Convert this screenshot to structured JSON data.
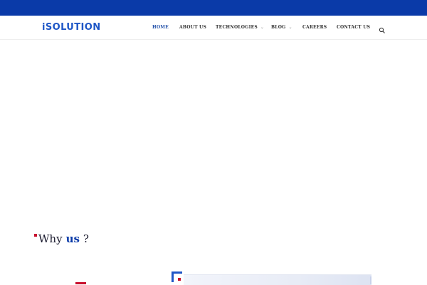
{
  "header": {
    "logo_text": "iSOLUTION",
    "nav": [
      {
        "label": "HOME",
        "active": true,
        "has_dropdown": false
      },
      {
        "label": "ABOUT US",
        "active": false,
        "has_dropdown": false
      },
      {
        "label": "TECHNOLOGIES",
        "active": false,
        "has_dropdown": true
      },
      {
        "label": "BLOG",
        "active": false,
        "has_dropdown": true
      },
      {
        "label": "CAREERS",
        "active": false,
        "has_dropdown": false
      },
      {
        "label": "CONTACT US",
        "active": false,
        "has_dropdown": false
      }
    ],
    "search_icon": "search-icon"
  },
  "section": {
    "why_text": "Why",
    "why_highlight": "us",
    "why_punct": "?"
  },
  "colors": {
    "brand_blue": "#0a3aa8",
    "accent_red": "#c8102e",
    "logo_blue": "#1e56c6"
  }
}
